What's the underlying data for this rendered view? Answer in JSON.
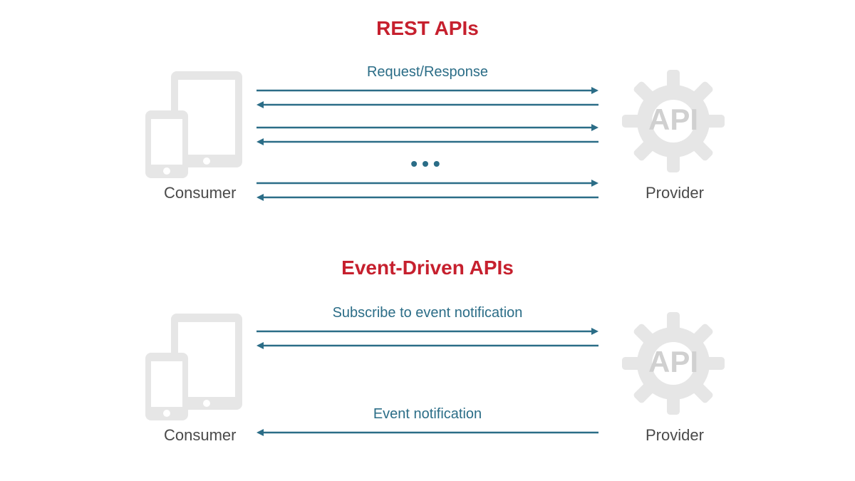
{
  "sections": {
    "rest": {
      "title": "REST APIs",
      "consumer_label": "Consumer",
      "provider_label": "Provider",
      "arrow_label": "Request/Response",
      "ellipsis": "•••",
      "gear_text": "API"
    },
    "event": {
      "title": "Event-Driven APIs",
      "consumer_label": "Consumer",
      "provider_label": "Provider",
      "subscribe_label": "Subscribe to event notification",
      "notify_label": "Event notification",
      "gear_text": "API"
    }
  },
  "colors": {
    "title": "#c6202e",
    "arrow": "#2b6d87",
    "icon": "#e6e6e6",
    "label": "#4a4a4a"
  }
}
